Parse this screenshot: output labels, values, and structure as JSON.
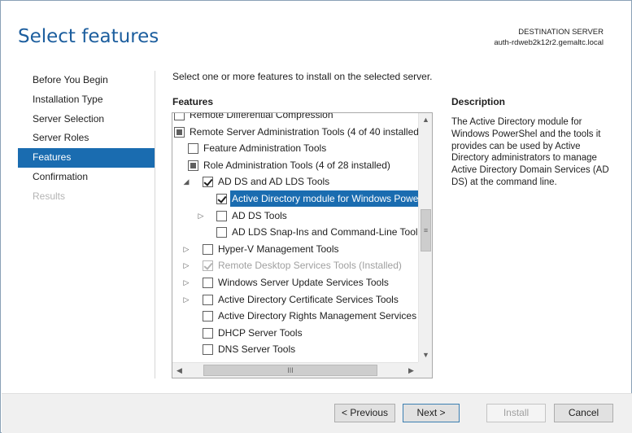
{
  "header": {
    "title": "Select features",
    "destination_label": "DESTINATION SERVER",
    "destination_server": "auth-rdweb2k12r2.gemaltc.local"
  },
  "nav": {
    "items": [
      {
        "label": "Before You Begin",
        "state": "normal"
      },
      {
        "label": "Installation Type",
        "state": "normal"
      },
      {
        "label": "Server Selection",
        "state": "normal"
      },
      {
        "label": "Server Roles",
        "state": "normal"
      },
      {
        "label": "Features",
        "state": "active"
      },
      {
        "label": "Confirmation",
        "state": "normal"
      },
      {
        "label": "Results",
        "state": "disabled"
      }
    ]
  },
  "main": {
    "instruction": "Select one or more features to install on the selected server.",
    "features_heading": "Features",
    "description_heading": "Description",
    "description_text": "The Active Directory module for Windows PowerShel and the tools it provides can be used by Active Directory administrators to manage Active Directory Domain Services (AD DS) at the command line."
  },
  "features": [
    {
      "label": "Remote Differential Compression",
      "level": 0,
      "expander": "none",
      "check": "none",
      "partial_clip": true
    },
    {
      "label": "Remote Server Administration Tools (4 of 40 installed)",
      "level": 0,
      "expander": "none",
      "check": "partial"
    },
    {
      "label": "Feature Administration Tools",
      "level": 1,
      "expander": "none",
      "check": "none"
    },
    {
      "label": "Role Administration Tools (4 of 28 installed)",
      "level": 1,
      "expander": "none",
      "check": "partial"
    },
    {
      "label": "AD DS and AD LDS Tools",
      "level": 2,
      "expander": "expanded",
      "check": "checked"
    },
    {
      "label": "Active Directory module for Windows PowerShell",
      "level": 3,
      "expander": "none",
      "check": "checked",
      "selected": true
    },
    {
      "label": "AD DS Tools",
      "level": 3,
      "expander": "collapsed",
      "check": "none"
    },
    {
      "label": "AD LDS Snap-Ins and Command-Line Tools",
      "level": 3,
      "expander": "none",
      "check": "none"
    },
    {
      "label": "Hyper-V Management Tools",
      "level": 2,
      "expander": "collapsed",
      "check": "none"
    },
    {
      "label": "Remote Desktop Services Tools (Installed)",
      "level": 2,
      "expander": "collapsed",
      "check": "checked",
      "disabled": true
    },
    {
      "label": "Windows Server Update Services Tools",
      "level": 2,
      "expander": "collapsed",
      "check": "none"
    },
    {
      "label": "Active Directory Certificate Services Tools",
      "level": 2,
      "expander": "collapsed",
      "check": "none"
    },
    {
      "label": "Active Directory Rights Management Services Tools",
      "level": 2,
      "expander": "none",
      "check": "none"
    },
    {
      "label": "DHCP Server Tools",
      "level": 2,
      "expander": "none",
      "check": "none"
    },
    {
      "label": "DNS Server Tools",
      "level": 2,
      "expander": "none",
      "check": "none"
    }
  ],
  "scrollbar": {
    "up_glyph": "▲",
    "down_glyph": "▼",
    "left_glyph": "◀",
    "right_glyph": "▶",
    "grip_glyph": "≡",
    "hgrip_glyph": "III"
  },
  "footer": {
    "previous_label": "< Previous",
    "next_label": "Next >",
    "install_label": "Install",
    "cancel_label": "Cancel"
  },
  "colors": {
    "accent": "#1a6cb0",
    "title": "#1c5e9e"
  }
}
